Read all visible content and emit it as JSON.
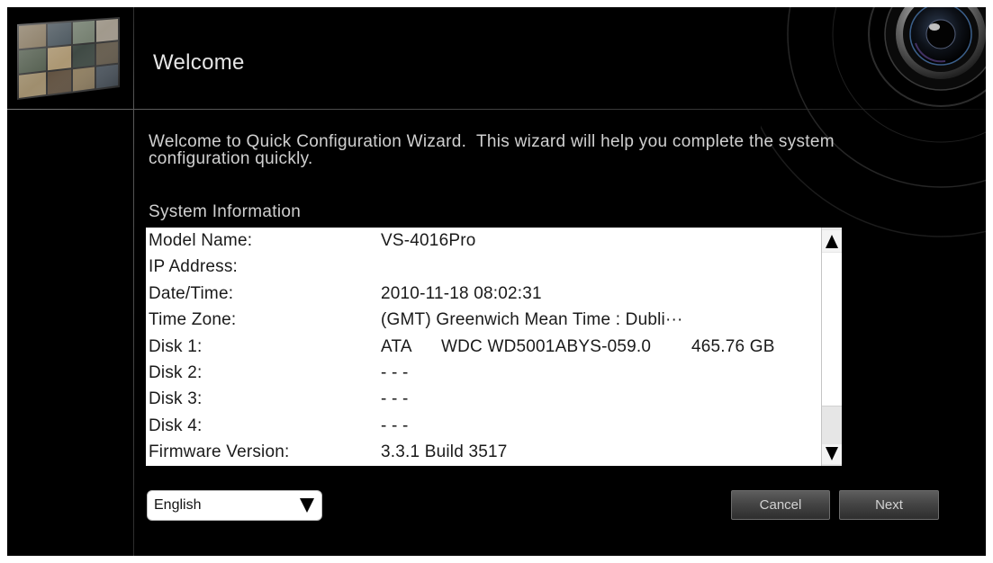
{
  "header": {
    "title": "Welcome"
  },
  "intro": {
    "lines": [
      "Welcome to Quick Configuration Wizard.  This wizard will help you complete the system",
      "configuration quickly."
    ]
  },
  "system_info": {
    "heading": "System Information",
    "rows": [
      {
        "label": "Model Name:",
        "value": "VS-4016Pro"
      },
      {
        "label": "IP Address:"
      },
      {
        "label": "Date/Time:",
        "value": "2010-11-18 08:02:31"
      },
      {
        "label": "Time Zone:",
        "value": "(GMT) Greenwich Mean Time : Dubli···"
      },
      {
        "label": "Disk 1:",
        "value_parts": [
          "ATA",
          "WDC WD5001ABYS-059.0",
          "465.76 GB"
        ]
      },
      {
        "label": "Disk 2:",
        "value": "- - -"
      },
      {
        "label": "Disk 3:",
        "value": "- - -"
      },
      {
        "label": "Disk 4:",
        "value": "- - -"
      },
      {
        "label": "Firmware Version:",
        "value": "3.3.1 Build 3517"
      }
    ]
  },
  "language_select": {
    "selected": "English"
  },
  "buttons": {
    "cancel": "Cancel",
    "next": "Next"
  },
  "icons": {
    "scroll_up": "scroll-up-arrow-icon",
    "scroll_down": "scroll-down-arrow-icon",
    "dropdown": "dropdown-arrow-icon",
    "lens": "camera-lens-icon"
  },
  "colors": {
    "background": "#000000",
    "text_light": "#d0d0d0",
    "list_background": "#ffffff",
    "button": "#454545"
  }
}
